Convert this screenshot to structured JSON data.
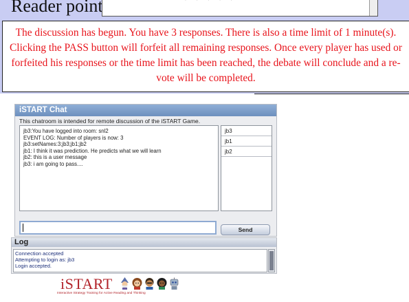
{
  "top": {
    "reader_points_label": "Reader points"
  },
  "notice": {
    "text": "The discussion has begun. You have 3 responses. There is also a time limit of 1 minute(s). Clicking the PASS button will forfeit all remaining responses. Once every player has used or forfeited his responses or the time limit has been reached, the debate will conclude and a re-vote will be completed.",
    "color": "#e8141c"
  },
  "chat": {
    "title": "iSTART Chat",
    "description": "This chatroom is intended for remote discussion of the iSTART Game.",
    "messages": [
      "jb3:You have logged into room: snl2",
      "EVENT LOG: Number of players is now: 3",
      "jb3:setNames:3;jb3;jb1;jb2",
      "jb1: I think it was prediction. He predicts what we will learn",
      "jb2: this is a user message",
      "jb3: i am going to pass...."
    ],
    "users": [
      "jb3",
      "jb1",
      "jb2"
    ],
    "input_value": "",
    "send_label": "Send",
    "title_color": "#7a9ac8"
  },
  "log": {
    "title": "Log",
    "lines": [
      "Connection accepted",
      "Attempting to login as: jb3",
      "Login accepted."
    ]
  },
  "logo": {
    "word": "iSTART",
    "tagline": "Interactive Strategy Training for Active Reading and Thinking",
    "color": "#b2232a"
  }
}
